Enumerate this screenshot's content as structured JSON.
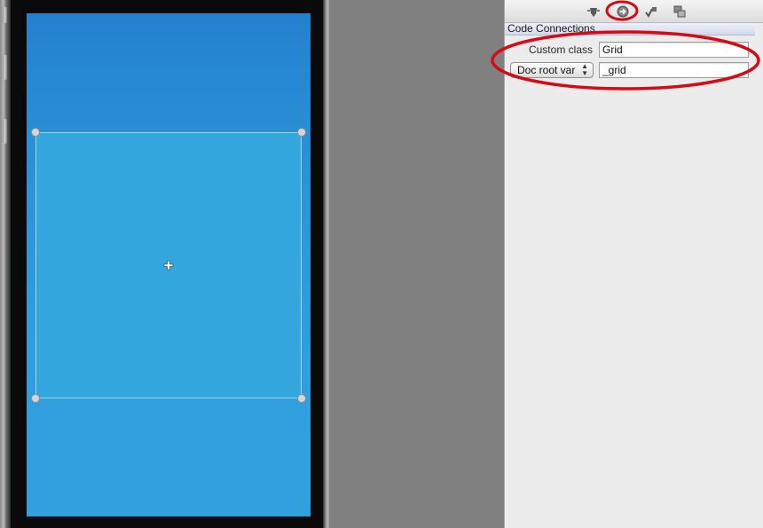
{
  "inspector": {
    "toolbar": {
      "icons": [
        "size-inspector-icon",
        "code-connections-icon",
        "callbacks-icon",
        "arrangement-icon"
      ],
      "active": "code-connections-icon"
    },
    "section_title": "Code Connections",
    "custom_class": {
      "label": "Custom class",
      "value": "Grid"
    },
    "doc_root_var": {
      "popup_label": "Doc root var",
      "value": "_grid"
    }
  },
  "colors": {
    "annotation_red": "#d60a14",
    "screen_top": "#2480cf",
    "screen_bottom": "#31a1de",
    "selected_node": "#33a6de"
  }
}
